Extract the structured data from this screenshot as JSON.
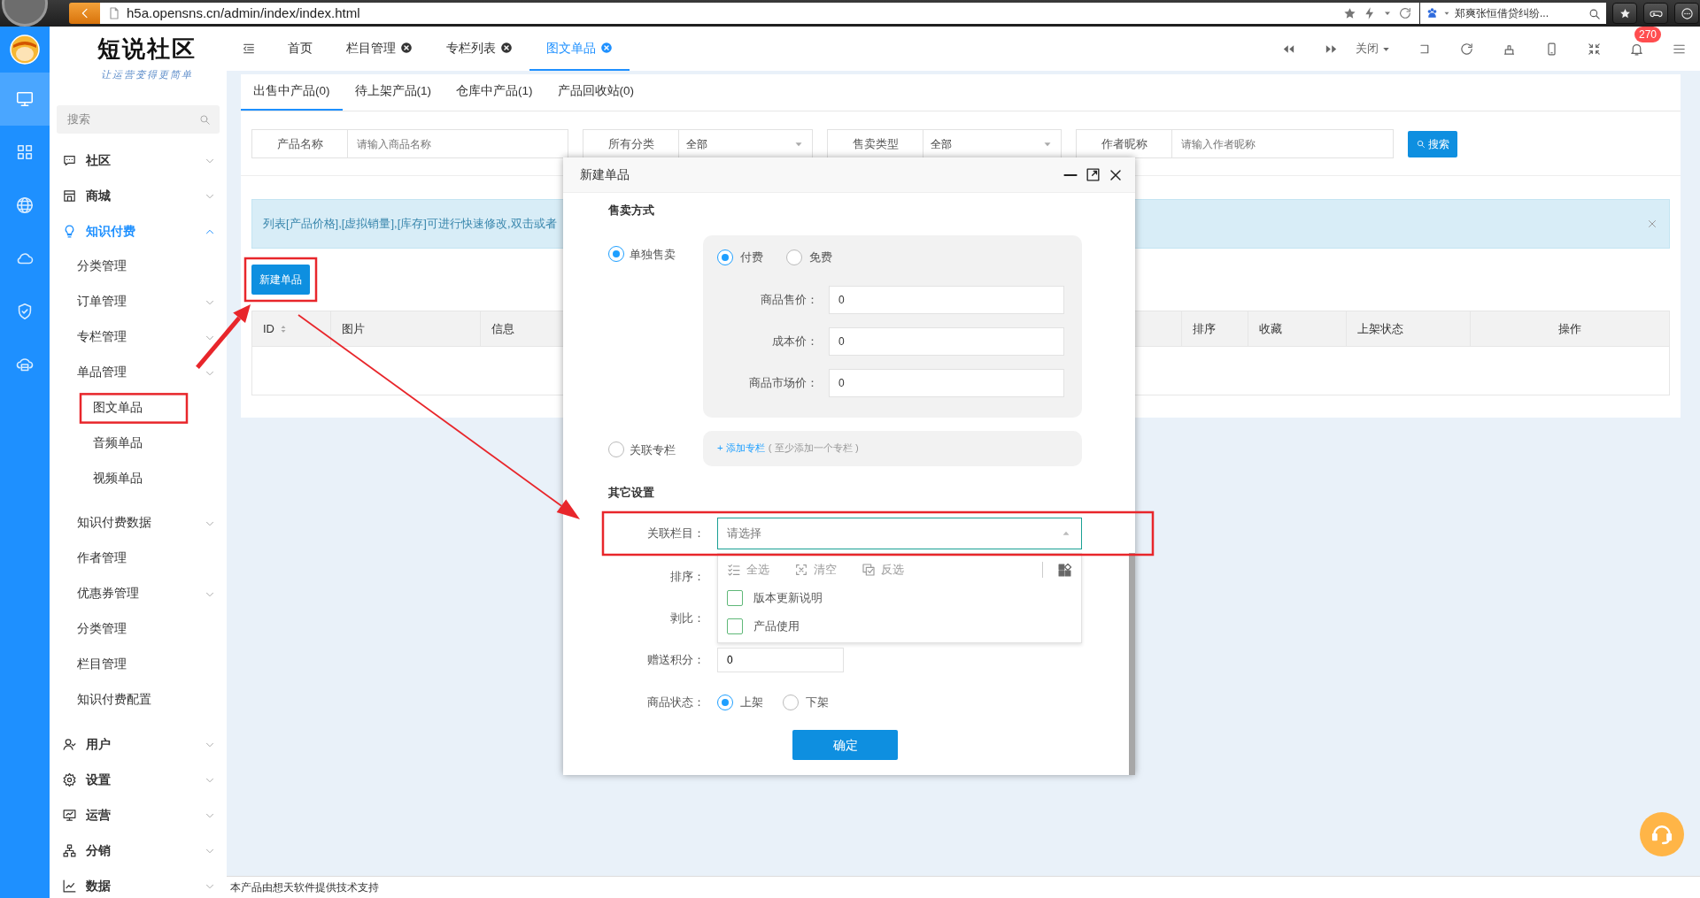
{
  "browser": {
    "url": "h5a.opensns.cn/admin/index/index.html",
    "search_text": "郑爽张恒借贷纠纷..."
  },
  "rail": [
    {
      "selected": true
    },
    {
      "selected": false
    },
    {
      "selected": false
    },
    {
      "selected": false
    },
    {
      "selected": false
    },
    {
      "selected": false
    }
  ],
  "sidebar": {
    "logo_title": "短说社区",
    "logo_subtitle": "让运营变得更简单",
    "search": {
      "placeholder": "搜索"
    },
    "groups": [
      {
        "label": "社区",
        "expanded": false
      },
      {
        "label": "商城",
        "expanded": false
      },
      {
        "label": "知识付费",
        "expanded": true,
        "children": [
          {
            "label": "分类管理",
            "expandable": false
          },
          {
            "label": "订单管理",
            "expandable": true
          },
          {
            "label": "专栏管理",
            "expandable": true
          },
          {
            "label": "单品管理",
            "expandable": true,
            "children": [
              {
                "label": "图文单品"
              },
              {
                "label": "音频单品"
              },
              {
                "label": "视频单品"
              }
            ]
          },
          {
            "label": "知识付费数据",
            "expandable": true
          },
          {
            "label": "作者管理",
            "expandable": false
          },
          {
            "label": "优惠券管理",
            "expandable": true
          },
          {
            "label": "分类管理",
            "expandable": false
          },
          {
            "label": "栏目管理",
            "expandable": false
          },
          {
            "label": "知识付费配置",
            "expandable": false
          }
        ]
      },
      {
        "label": "用户",
        "expanded": false
      },
      {
        "label": "设置",
        "expanded": false
      },
      {
        "label": "运营",
        "expanded": false
      },
      {
        "label": "分销",
        "expanded": false
      },
      {
        "label": "数据",
        "expanded": false
      }
    ]
  },
  "header": {
    "tabs": [
      {
        "label": "首页",
        "closable": false,
        "selected": false
      },
      {
        "label": "栏目管理",
        "closable": true,
        "selected": false
      },
      {
        "label": "专栏列表",
        "closable": true,
        "selected": false
      },
      {
        "label": "图文单品",
        "closable": true,
        "selected": true
      }
    ],
    "close_menu": "关闭",
    "notifications": "270"
  },
  "main": {
    "tabs": [
      {
        "label": "出售中产品(0)",
        "selected": true
      },
      {
        "label": "待上架产品(1)",
        "selected": false
      },
      {
        "label": "仓库中产品(1)",
        "selected": false
      },
      {
        "label": "产品回收站(0)",
        "selected": false
      }
    ],
    "filters": [
      {
        "label": "产品名称",
        "kind": "text",
        "placeholder": "请输入商品名称"
      },
      {
        "label": "所有分类",
        "kind": "select",
        "value": "全部"
      },
      {
        "label": "售卖类型",
        "kind": "select",
        "value": "全部"
      },
      {
        "label": "作者昵称",
        "kind": "text",
        "placeholder": "请输入作者昵称"
      }
    ],
    "search_button": "搜索",
    "alert": "列表[产品价格],[虚拟销量],[库存]可进行快速修改,双击或者",
    "new_button": "新建单品",
    "table": {
      "columns": [
        {
          "label": "ID",
          "sortable": true
        },
        {
          "label": "图片",
          "sortable": false
        },
        {
          "label": "信息",
          "sortable": false
        },
        {
          "label": "排序",
          "sortable": false
        },
        {
          "label": "收藏",
          "sortable": false
        },
        {
          "label": "上架状态",
          "sortable": false
        },
        {
          "label": "操作",
          "sortable": false
        }
      ]
    }
  },
  "modal": {
    "title": "新建单品",
    "sale_title": "售卖方式",
    "sale_modes": [
      {
        "label": "单独售卖",
        "selected": true
      },
      {
        "label": "关联专栏",
        "selected": false
      }
    ],
    "pay_options": [
      {
        "label": "付费",
        "selected": true
      },
      {
        "label": "免费",
        "selected": false
      }
    ],
    "price_fields": [
      {
        "label": "商品售价：",
        "value": "0"
      },
      {
        "label": "成本价：",
        "value": "0"
      },
      {
        "label": "商品市场价：",
        "value": "0"
      }
    ],
    "add_column_link": "+ 添加专栏",
    "add_column_hint": "( 至少添加一个专栏 )",
    "other_title": "其它设置",
    "related": {
      "label": "关联栏目：",
      "placeholder": "请选择",
      "expanded": true,
      "actions": [
        {
          "label": "全选"
        },
        {
          "label": "清空"
        },
        {
          "label": "反选"
        }
      ],
      "options": [
        {
          "label": "版本更新说明",
          "checked": false
        },
        {
          "label": "产品使用",
          "checked": false
        }
      ]
    },
    "rows": [
      {
        "label": "排序："
      },
      {
        "label": "剥比："
      },
      {
        "label": "赠送积分：",
        "value": "0"
      }
    ],
    "status": {
      "label": "商品状态：",
      "options": [
        {
          "label": "上架",
          "selected": true
        },
        {
          "label": "下架",
          "selected": false
        }
      ]
    },
    "submit": "确定"
  },
  "footer": "本产品由想天软件提供技术支持"
}
